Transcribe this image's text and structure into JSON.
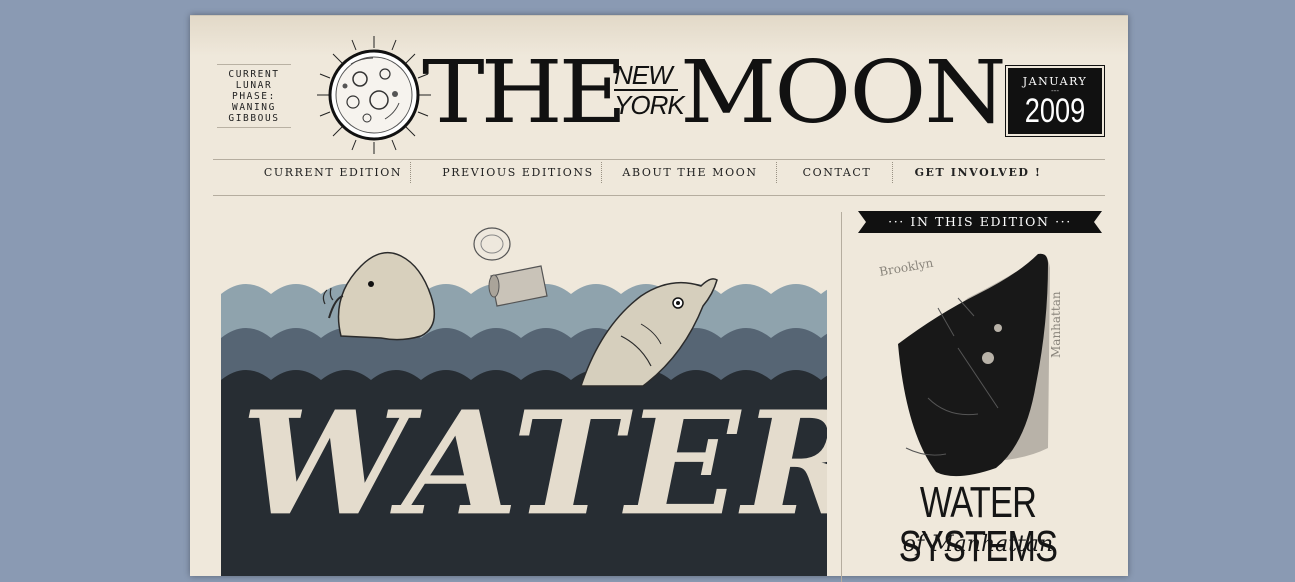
{
  "masthead": {
    "phase_lines": [
      "CURRENT",
      "LUNAR",
      "PHASE:",
      "WANING",
      "GIBBOUS"
    ],
    "title_the": "THE",
    "title_new": "NEW",
    "title_york": "YORK",
    "title_moon": "MOON",
    "logo_icon": "moon-icon"
  },
  "edition_date": {
    "month": "JANUARY",
    "separator": "---",
    "year": "2009"
  },
  "nav": {
    "items": [
      {
        "label": "CURRENT EDITION"
      },
      {
        "label": "PREVIOUS EDITIONS"
      },
      {
        "label": "ABOUT THE MOON"
      },
      {
        "label": "CONTACT"
      },
      {
        "label": "GET INVOLVED !"
      }
    ]
  },
  "hero": {
    "headline": "WATER"
  },
  "sidebar": {
    "banner_label": "··· IN THIS EDITION ···",
    "map_label_brooklyn": "Brooklyn",
    "map_label_manhattan": "Manhattan",
    "feature_title": "WATER SYSTEMS",
    "feature_subtitle": "of Manhattan"
  },
  "colors": {
    "background": "#8a9ab3",
    "paper": "#efe8db",
    "ink": "#111111",
    "water_light": "#8fa3ad",
    "water_mid": "#566574",
    "water_dark": "#272d33"
  }
}
